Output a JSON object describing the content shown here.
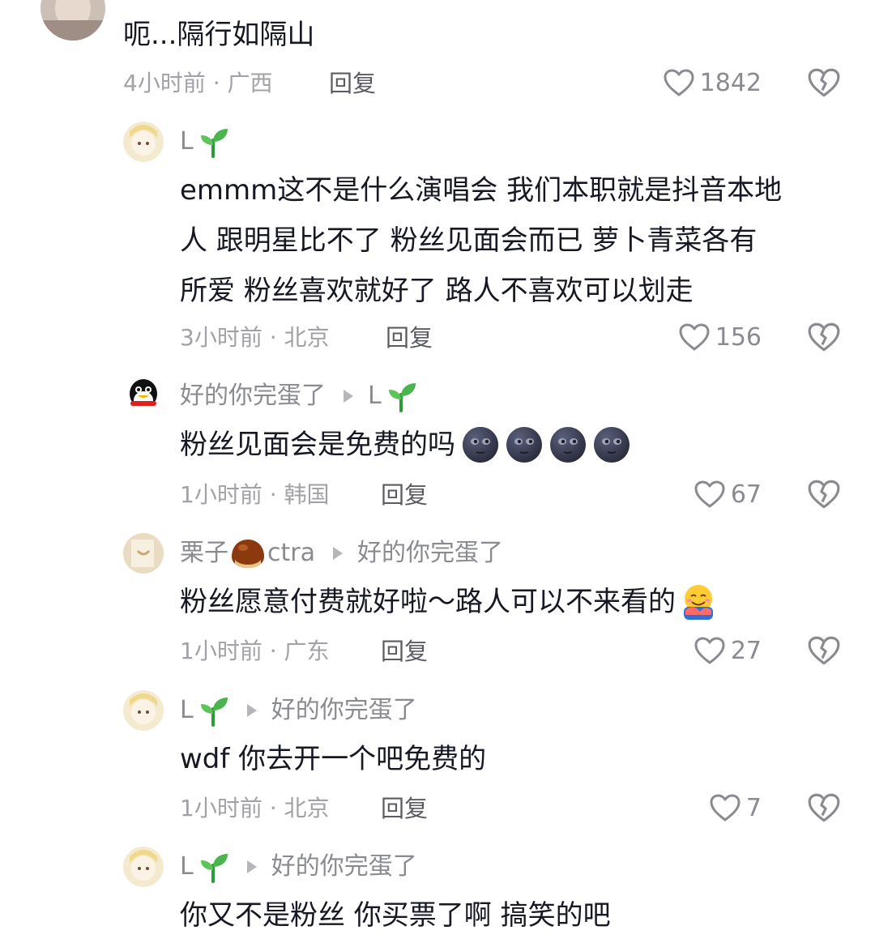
{
  "comments": [
    {
      "text": "呃...隔行如隔山",
      "time": "4小时前 · 广西",
      "reply": "回复",
      "likes": "1842"
    }
  ],
  "replies": [
    {
      "user": "L",
      "text_lines": [
        "emmm这不是什么演唱会  我们本职就是抖音本地",
        "人  跟明星比不了  粉丝见面会而已  萝卜青菜各有",
        "所爱  粉丝喜欢就好了  路人不喜欢可以划走"
      ],
      "time": "3小时前 · 北京",
      "reply": "回复",
      "likes": "156"
    },
    {
      "user": "好的你完蛋了",
      "reply_to": "L",
      "text": "粉丝见面会是免费的吗",
      "emojis": [
        "new-moon-face-emoji",
        "new-moon-face-emoji",
        "new-moon-face-emoji",
        "new-moon-face-emoji"
      ],
      "time": "1小时前 · 韩国",
      "reply": "回复",
      "likes": "67"
    },
    {
      "user_prefix": "栗子",
      "user_suffix": "ctra",
      "reply_to": "好的你完蛋了",
      "text": "粉丝愿意付费就好啦～路人可以不来看的",
      "emoji": "hugging-face-emoji",
      "time": "1小时前 · 广东",
      "reply": "回复",
      "likes": "27"
    },
    {
      "user": "L",
      "reply_to": "好的你完蛋了",
      "text": "wdf  你去开一个吧免费的",
      "time": "1小时前 · 北京",
      "reply": "回复",
      "likes": "7"
    },
    {
      "user": "L",
      "reply_to": "好的你完蛋了",
      "text": "你又不是粉丝  你买票了啊  搞笑的吧"
    }
  ],
  "colors": {
    "text": "#161823",
    "meta": "#a1a2a7",
    "name": "#8a8b91",
    "sprout": "#2e9b3a"
  }
}
